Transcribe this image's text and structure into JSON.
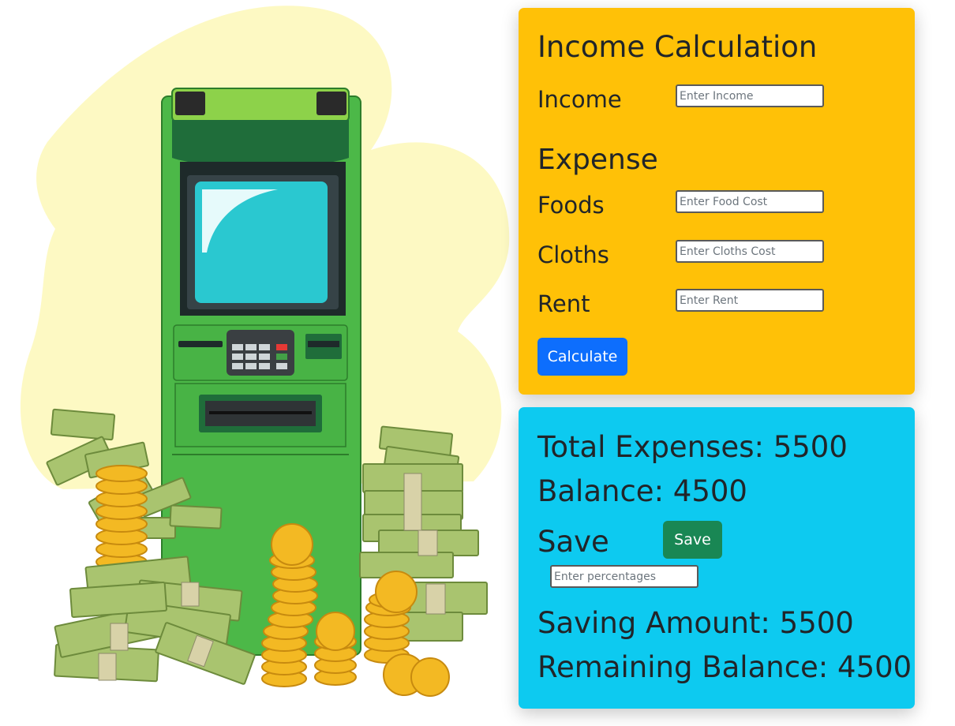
{
  "income_card": {
    "title": "Income Calculation",
    "income_label": "Income",
    "income_placeholder": "Enter Income",
    "expense_heading": "Expense",
    "foods_label": "Foods",
    "foods_placeholder": "Enter Food Cost",
    "cloths_label": "Cloths",
    "cloths_placeholder": "Enter Cloths Cost",
    "rent_label": "Rent",
    "rent_placeholder": "Enter Rent",
    "calculate_label": "Calculate"
  },
  "result_card": {
    "total_expenses_label": "Total Expenses: ",
    "total_expenses_value": "5500",
    "balance_label": "Balance: ",
    "balance_value": "4500",
    "save_label": "Save",
    "save_button_label": "Save",
    "percent_placeholder": "Enter percentages",
    "saving_amount_label": "Saving Amount: ",
    "saving_amount_value": "5500",
    "remaining_balance_label": "Remaining Balance: ",
    "remaining_balance_value": "4500"
  },
  "colors": {
    "income_card_bg": "#ffc107",
    "result_card_bg": "#0dcaf0",
    "primary_button": "#0d6efd",
    "success_button": "#198754",
    "atm_green": "#4cb848",
    "atm_screen": "#2ac8d0",
    "blob": "#fdf9c3"
  },
  "illustration": {
    "name": "atm-money-illustration"
  }
}
